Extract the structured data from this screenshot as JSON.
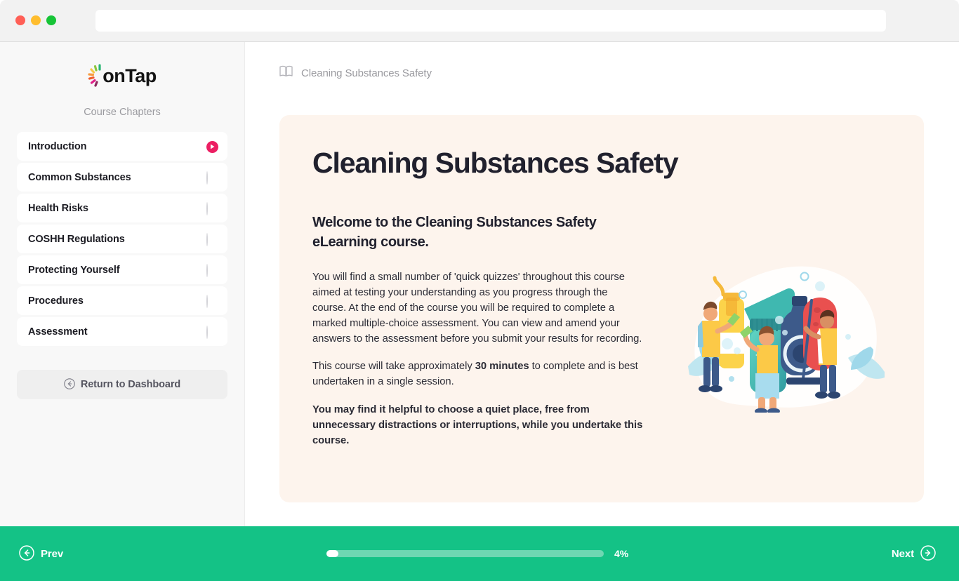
{
  "browser": {
    "address_value": "",
    "address_placeholder": ""
  },
  "sidebar": {
    "logo_text": "onTap",
    "chapters_label": "Course Chapters",
    "items": [
      {
        "label": "Introduction",
        "status": "play"
      },
      {
        "label": "Common Substances",
        "status": "circle"
      },
      {
        "label": "Health Risks",
        "status": "circle"
      },
      {
        "label": "COSHH Regulations",
        "status": "circle"
      },
      {
        "label": "Protecting Yourself",
        "status": "circle"
      },
      {
        "label": "Procedures",
        "status": "circle"
      },
      {
        "label": "Assessment",
        "status": "circle"
      }
    ],
    "return_label": "Return to Dashboard"
  },
  "breadcrumb": {
    "text": "Cleaning Substances Safety"
  },
  "card": {
    "title": "Cleaning Substances Safety",
    "subtitle": "Welcome to the Cleaning Substances Safety eLearning course.",
    "para1": "You will find a small number of 'quick quizzes' throughout this course aimed at testing your understanding as you progress through the course.  At the end of the course you will be required to complete a marked multiple-choice assessment. You can view and amend your answers to the assessment before you submit your results for recording.",
    "para2_before": "This course will take approximately ",
    "para2_bold": "30 minutes",
    "para2_after": " to complete and is best undertaken in a single session.",
    "para3": "You may find it helpful to choose a quiet place, free from unnecessary distractions or interruptions, while you undertake this course."
  },
  "footer": {
    "prev_label": "Prev",
    "next_label": "Next",
    "progress_percent": 4,
    "progress_label": "4%"
  },
  "colors": {
    "accent_green": "#14c286",
    "accent_pink": "#ec1f63",
    "card_bg": "#fdf4ed",
    "sidebar_bg": "#f8f8f8",
    "text_dark": "#21212e",
    "text_muted": "#9a9a9f"
  }
}
